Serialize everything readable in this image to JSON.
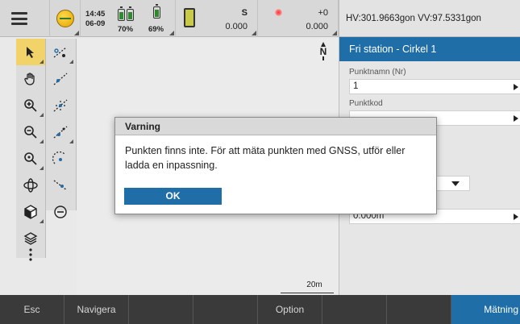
{
  "statusbar": {
    "menu_icon": "hamburger-icon",
    "gnss_icon": "globe-icon",
    "time": "14:45",
    "date": "06-09",
    "battery1_percent": "70%",
    "battery2_percent": "69%",
    "instrument_icon": "total-station-icon",
    "s_label": "S",
    "s_value": "0.000",
    "laser_icon": "laser-icon",
    "plus_label": "+0",
    "plus_value": "0.000"
  },
  "header": {
    "angles": "HV:301.9663gon  VV:97.5331gon"
  },
  "map": {
    "north_label": "N",
    "scale_label": "20m"
  },
  "panel": {
    "title": "Fri station - Cirkel 1",
    "point_name_label": "Punktnamn (Nr)",
    "point_name_value": "1",
    "point_code_label": "Punktkod",
    "point_code_value": "",
    "height_value": "0.000m"
  },
  "dialog": {
    "title": "Varning",
    "message": "Punkten finns inte. För att mäta punkten med GNSS, utför eller ladda en inpassning.",
    "ok_label": "OK"
  },
  "softkeys": {
    "esc": "Esc",
    "navigate": "Navigera",
    "blank1": "",
    "blank2": "",
    "option": "Option",
    "blank3": "",
    "blank4": "",
    "measure": "Mätning"
  },
  "colors": {
    "accent_blue": "#1f6ea8",
    "tool_selected": "#f1d36a",
    "softkey_bg": "#3a3a3a"
  }
}
